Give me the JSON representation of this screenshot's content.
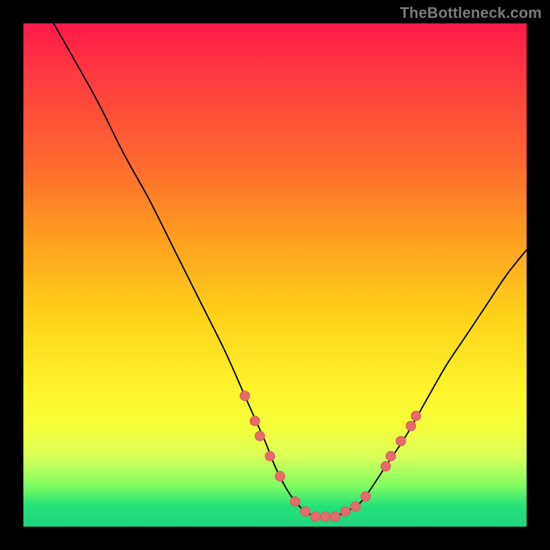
{
  "watermark": "TheBottleneck.com",
  "colors": {
    "background": "#000000",
    "curve": "#000000",
    "marker_fill": "#e96a6a",
    "marker_stroke": "#cf5a5a",
    "gradient_top": "#ff1a4a",
    "gradient_bottom": "#20d57e"
  },
  "chart_data": {
    "type": "line",
    "title": "",
    "xlabel": "",
    "ylabel": "",
    "xlim": [
      0,
      100
    ],
    "ylim": [
      0,
      100
    ],
    "series": [
      {
        "name": "bottleneck-curve",
        "x": [
          6,
          10,
          15,
          20,
          25,
          30,
          35,
          40,
          44,
          48,
          50,
          52,
          54,
          56,
          58,
          60,
          62,
          64,
          66,
          68,
          72,
          76,
          80,
          84,
          88,
          92,
          96,
          100
        ],
        "y": [
          100,
          93,
          84,
          74,
          65,
          55,
          45,
          35,
          26,
          17,
          12,
          8,
          5,
          3,
          2,
          2,
          2,
          3,
          4,
          6,
          12,
          18,
          25,
          32,
          38,
          44,
          50,
          55
        ]
      }
    ],
    "markers": {
      "name": "highlight-points",
      "points": [
        {
          "x": 44,
          "y": 26
        },
        {
          "x": 46,
          "y": 21
        },
        {
          "x": 47,
          "y": 18
        },
        {
          "x": 49,
          "y": 14
        },
        {
          "x": 51,
          "y": 10
        },
        {
          "x": 54,
          "y": 5
        },
        {
          "x": 56,
          "y": 3
        },
        {
          "x": 58,
          "y": 2
        },
        {
          "x": 60,
          "y": 2
        },
        {
          "x": 62,
          "y": 2
        },
        {
          "x": 64,
          "y": 3
        },
        {
          "x": 66,
          "y": 4
        },
        {
          "x": 68,
          "y": 6
        },
        {
          "x": 72,
          "y": 12
        },
        {
          "x": 73,
          "y": 14
        },
        {
          "x": 75,
          "y": 17
        },
        {
          "x": 77,
          "y": 20
        },
        {
          "x": 78,
          "y": 22
        }
      ]
    }
  }
}
